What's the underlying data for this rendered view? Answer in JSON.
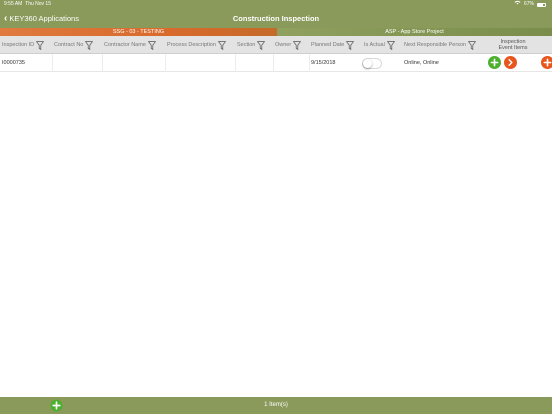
{
  "status_bar": {
    "time": "9:55 AM",
    "date": "Thu Nov 15",
    "battery": "67%"
  },
  "nav": {
    "back_label": "KEY360 Applications",
    "title": "Construction Inspection"
  },
  "band": {
    "left": "SSG - 03 - TESTING",
    "right": "ASP - App Store Project"
  },
  "columns": [
    {
      "label": "Inspection ID"
    },
    {
      "label": "Contract No"
    },
    {
      "label": "Contractor Name"
    },
    {
      "label": "Process Description"
    },
    {
      "label": "Section"
    },
    {
      "label": "Owner"
    },
    {
      "label": "Planned Date"
    },
    {
      "label": "Is Actual"
    },
    {
      "label": "Next Responsible Person"
    }
  ],
  "inspection_event_items_header": [
    "Inspection",
    "Event Items"
  ],
  "rows": [
    {
      "inspection_id": "I0000735",
      "contract_no": "",
      "contractor_name": "",
      "process_description": "",
      "section": "",
      "owner": "",
      "planned_date": "9/15/2018",
      "is_actual": false,
      "next_responsible_person": "Online, Online"
    }
  ],
  "footer": {
    "count": "1 Item(s)"
  },
  "colors": {
    "bar": "#8a9a5b",
    "band_orange": "#d86a2c",
    "band_green": "#8a9a5b",
    "add_green": "#4caf2e",
    "action_orange": "#e8561e"
  }
}
